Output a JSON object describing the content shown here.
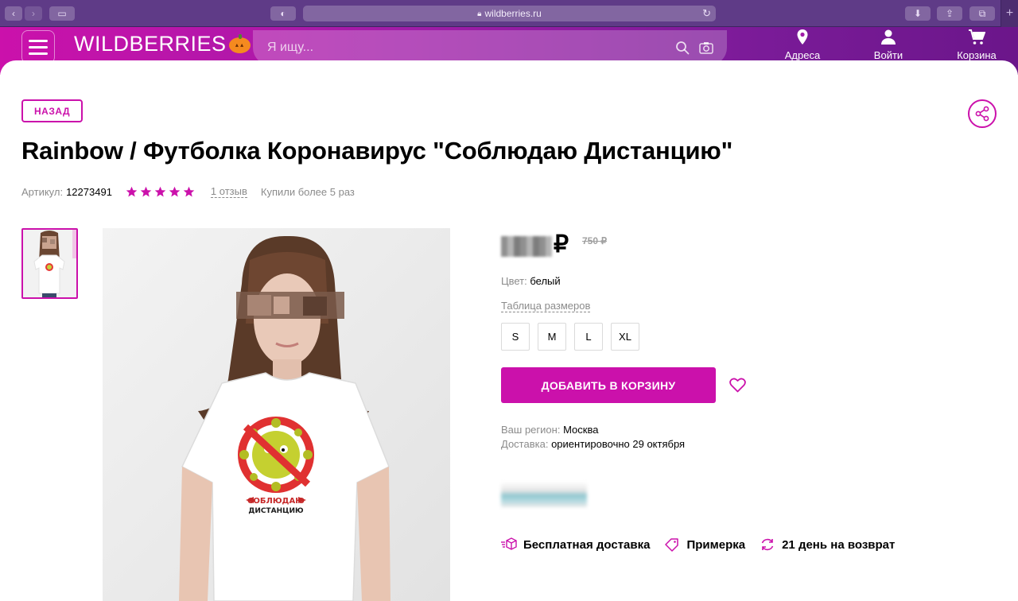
{
  "browser": {
    "url": "wildberries.ru"
  },
  "header": {
    "logo": "WILDBERRIES",
    "search_placeholder": "Я ищу...",
    "nav": {
      "addresses": "Адреса",
      "login": "Войти",
      "cart": "Корзина"
    }
  },
  "product": {
    "back_label": "НАЗАД",
    "title": "Rainbow / Футболка Коронавирус \"Соблюдаю Дистанцию\"",
    "article_label": "Артикул:",
    "article_value": "12273491",
    "rating": 5,
    "reviews": "1 отзыв",
    "bought": "Купили более 5 раз",
    "currency": "₽",
    "old_price": "750 ₽",
    "color_label": "Цвет:",
    "color_value": "белый",
    "size_table": "Таблица размеров",
    "sizes": [
      "S",
      "M",
      "L",
      "XL"
    ],
    "add_to_cart": "ДОБАВИТЬ В КОРЗИНУ",
    "region_label": "Ваш регион:",
    "region_value": "Москва",
    "delivery_label": "Доставка:",
    "delivery_value": "ориентировочно 29 октября",
    "features": [
      "Бесплатная доставка",
      "Примерка",
      "21 день на возврат"
    ],
    "tshirt_print_line1": "СОБЛЮДАЮ",
    "tshirt_print_line2": "ДИСТАНЦИЮ"
  },
  "colors": {
    "brand": "#cb11ab",
    "header_end": "#6b168a",
    "star": "#cb11ab"
  }
}
